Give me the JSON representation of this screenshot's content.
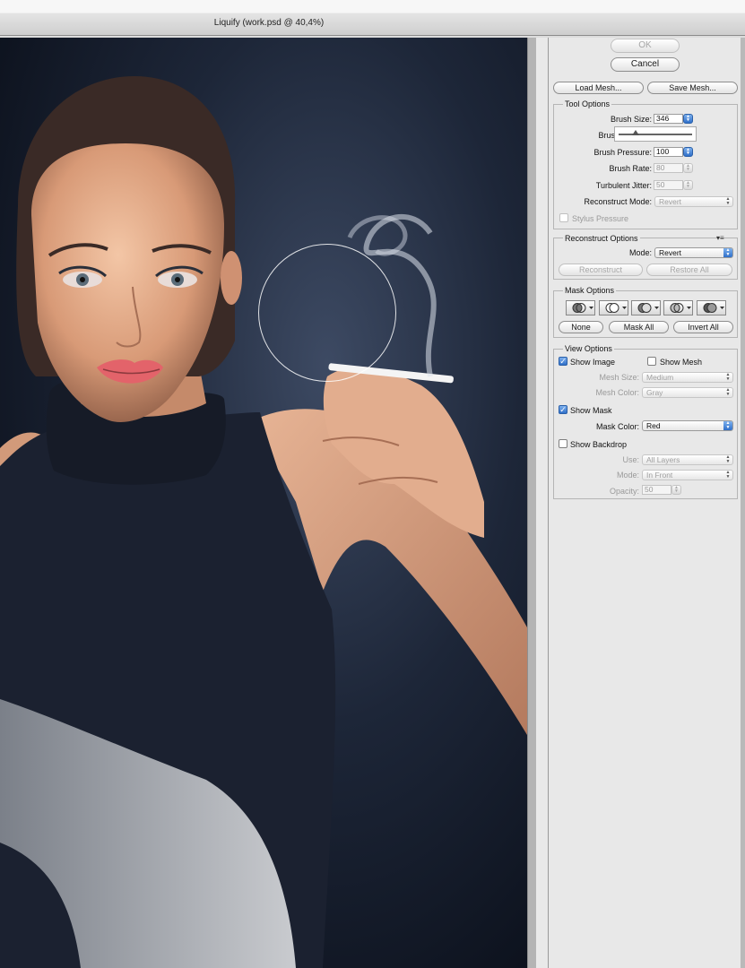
{
  "window": {
    "title": "Liquify (work.psd @ 40,4%)"
  },
  "buttons": {
    "ok": "OK",
    "cancel": "Cancel",
    "load_mesh": "Load Mesh...",
    "save_mesh": "Save Mesh..."
  },
  "tool_options": {
    "title": "Tool Options",
    "brush_size_label": "Brush Size:",
    "brush_size": "346",
    "brush_density_label": "Brus",
    "brush_pressure_label": "Brush Pressure:",
    "brush_pressure": "100",
    "brush_rate_label": "Brush Rate:",
    "brush_rate": "80",
    "turbulent_jitter_label": "Turbulent Jitter:",
    "turbulent_jitter": "50",
    "reconstruct_mode_label": "Reconstruct Mode:",
    "reconstruct_mode": "Revert",
    "stylus_pressure": "Stylus Pressure"
  },
  "reconstruct_options": {
    "title": "Reconstruct Options",
    "mode_label": "Mode:",
    "mode": "Revert",
    "reconstruct_button": "Reconstruct",
    "restore_all_button": "Restore All"
  },
  "mask_options": {
    "title": "Mask Options",
    "none_button": "None",
    "mask_all_button": "Mask All",
    "invert_all_button": "Invert All"
  },
  "view_options": {
    "title": "View Options",
    "show_image": "Show Image",
    "show_mesh": "Show Mesh",
    "mesh_size_label": "Mesh Size:",
    "mesh_size": "Medium",
    "mesh_color_label": "Mesh Color:",
    "mesh_color": "Gray",
    "show_mask": "Show Mask",
    "mask_color_label": "Mask Color:",
    "mask_color": "Red",
    "show_backdrop": "Show Backdrop",
    "use_label": "Use:",
    "use": "All Layers",
    "mode_label": "Mode:",
    "mode": "In Front",
    "opacity_label": "Opacity:",
    "opacity": "50"
  },
  "state": {
    "show_image": true,
    "show_mesh": false,
    "show_mask": true,
    "show_backdrop": false,
    "stylus_pressure": false,
    "brush_slider_fraction": 0.23
  },
  "colors": {
    "accent": "#2f6fc9",
    "panel": "#e8e8e8",
    "canvas_dark": "#0c111c"
  }
}
